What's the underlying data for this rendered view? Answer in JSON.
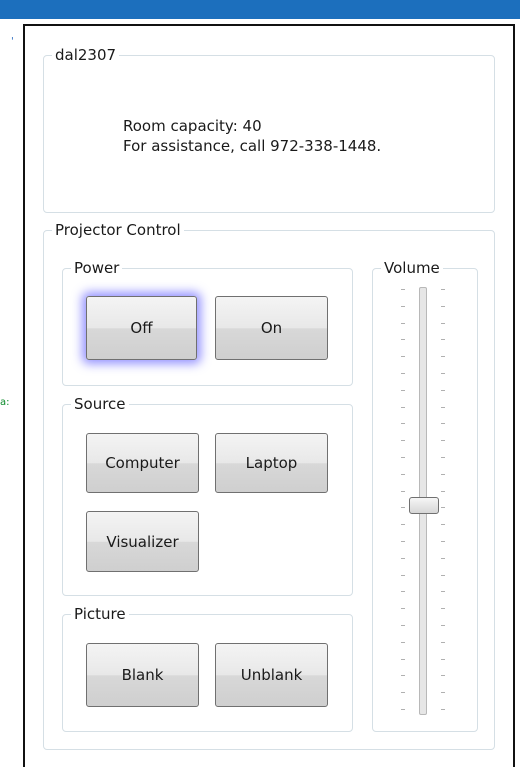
{
  "window": {
    "accent": "#1c6fbd"
  },
  "room": {
    "legend": "dal2307",
    "capacity_text": "Room capacity: 40",
    "assistance_text": "For assistance, call 972-338-1448."
  },
  "projector": {
    "legend": "Projector Control",
    "power": {
      "legend": "Power",
      "off_label": "Off",
      "on_label": "On"
    },
    "source": {
      "legend": "Source",
      "computer_label": "Computer",
      "laptop_label": "Laptop",
      "visualizer_label": "Visualizer"
    },
    "picture": {
      "legend": "Picture",
      "blank_label": "Blank",
      "unblank_label": "Unblank"
    },
    "volume": {
      "legend": "Volume",
      "level_fraction": 0.49
    }
  }
}
